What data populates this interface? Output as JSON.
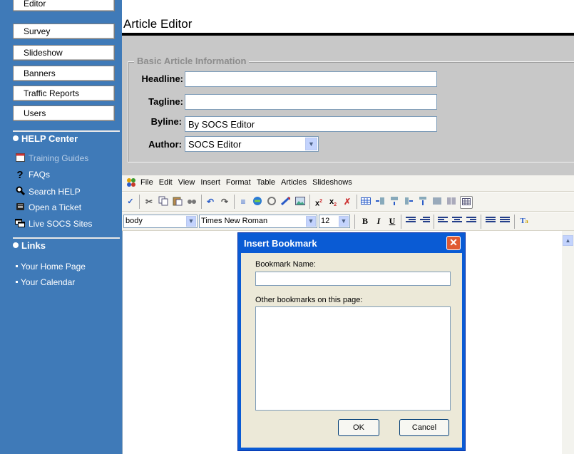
{
  "sidebar": {
    "buttons": [
      "Editor",
      "Survey",
      "Slideshow",
      "Banners",
      "Traffic Reports",
      "Users"
    ],
    "help_title": "HELP Center",
    "help_links": [
      {
        "label": "Training Guides",
        "icon": "book-icon"
      },
      {
        "label": "FAQs",
        "icon": "question-icon"
      },
      {
        "label": "Search HELP",
        "icon": "magnifier-icon"
      },
      {
        "label": "Open a Ticket",
        "icon": "ticket-icon"
      },
      {
        "label": "Live SOCS Sites",
        "icon": "windows-icon"
      }
    ],
    "links_title": "Links",
    "links": [
      "Your Home Page",
      "Your Calendar"
    ]
  },
  "main": {
    "title": "Article Editor",
    "fieldset_legend": "Basic Article Information",
    "fields": {
      "headline": {
        "label": "Headline:",
        "value": ""
      },
      "tagline": {
        "label": "Tagline:",
        "value": ""
      },
      "byline": {
        "label": "Byline:",
        "value": "By SOCS Editor"
      },
      "author": {
        "label": "Author:",
        "value": "SOCS Editor"
      }
    }
  },
  "editor": {
    "menu": [
      "File",
      "Edit",
      "View",
      "Insert",
      "Format",
      "Table",
      "Articles",
      "Slideshows"
    ],
    "style_select": "body",
    "font_select": "Times New Roman",
    "size_select": "12"
  },
  "dialog": {
    "title": "Insert Bookmark",
    "name_label": "Bookmark Name:",
    "name_value": "",
    "list_label": "Other bookmarks on this page:",
    "ok": "OK",
    "cancel": "Cancel"
  },
  "colors": {
    "sidebar": "#3f7ab8",
    "dialog_title": "#0a5bd4",
    "panel": "#c8c8c8"
  }
}
